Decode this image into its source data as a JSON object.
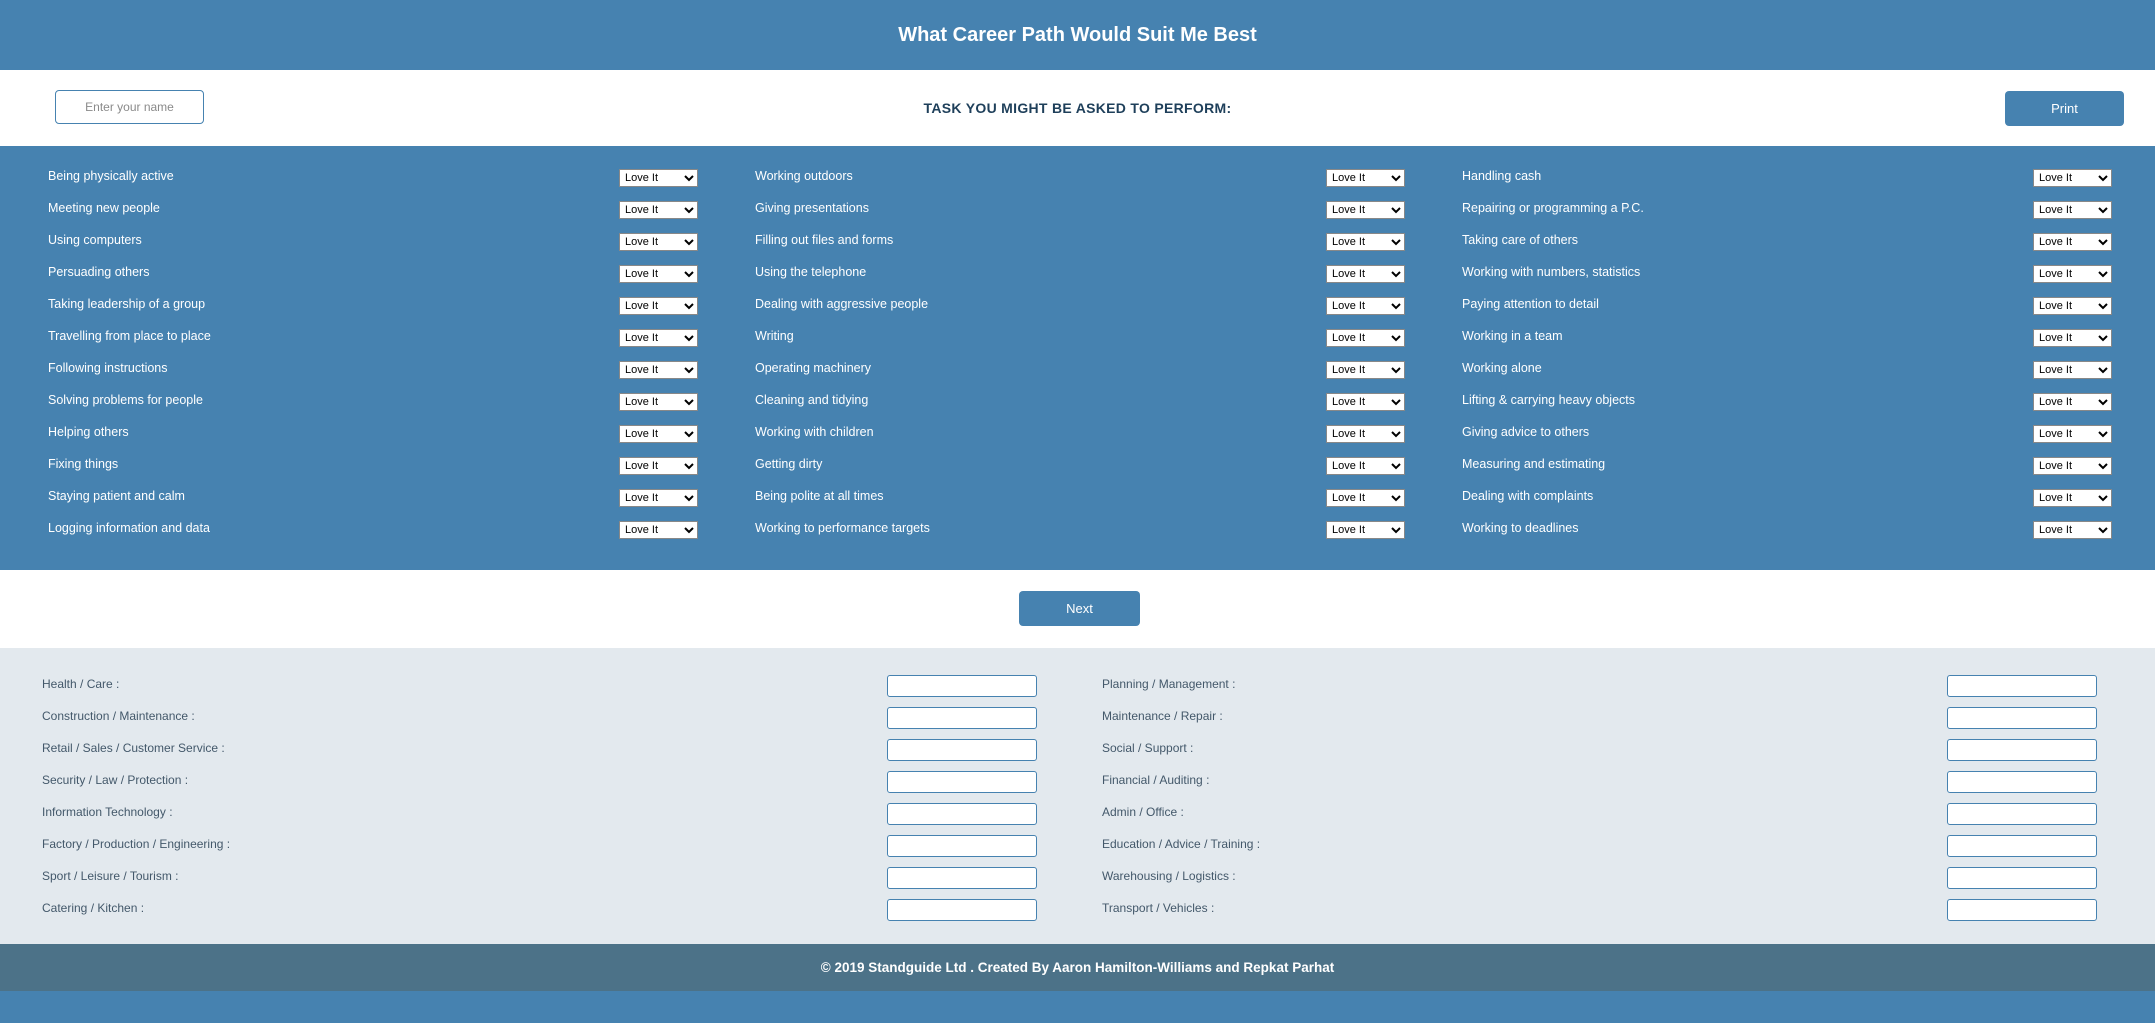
{
  "header": {
    "title": "What Career Path Would Suit Me Best"
  },
  "name_bar": {
    "name_placeholder": "Enter your name",
    "task_heading": "TASK YOU MIGHT BE ASKED TO PERFORM:",
    "print_label": "Print"
  },
  "tasks": {
    "selected_value": "Love It",
    "columns": [
      [
        "Being physically active",
        "Meeting new people",
        "Using computers",
        "Persuading others",
        "Taking leadership of a group",
        "Travelling from place to place",
        "Following instructions",
        "Solving problems for people",
        "Helping others",
        "Fixing things",
        "Staying patient and calm",
        "Logging information and data"
      ],
      [
        "Working outdoors",
        "Giving presentations",
        "Filling out files and forms",
        "Using the telephone",
        "Dealing with aggressive people",
        "Writing",
        "Operating machinery",
        "Cleaning and tidying",
        "Working with children",
        "Getting dirty",
        "Being polite at all times",
        "Working to performance targets"
      ],
      [
        "Handling cash",
        "Repairing or programming a P.C.",
        "Taking care of others",
        "Working with numbers, statistics",
        "Paying attention to detail",
        "Working in a team",
        "Working alone",
        "Lifting & carrying heavy objects",
        "Giving advice to others",
        "Measuring and estimating",
        "Dealing with complaints",
        "Working to deadlines"
      ]
    ]
  },
  "next_label": "Next",
  "results": {
    "columns": [
      [
        "Health / Care :",
        "Construction / Maintenance :",
        "Retail / Sales / Customer Service :",
        "Security / Law / Protection :",
        "Information Technology :",
        "Factory / Production / Engineering :",
        "Sport / Leisure / Tourism :",
        "Catering / Kitchen :"
      ],
      [
        "Planning / Management :",
        "Maintenance / Repair :",
        "Social / Support :",
        "Financial / Auditing :",
        "Admin / Office :",
        "Education / Advice / Training :",
        "Warehousing / Logistics :",
        "Transport / Vehicles :"
      ]
    ]
  },
  "footer": {
    "text": "© 2019 Standguide Ltd . Created By Aaron Hamilton-Williams and Repkat Parhat"
  },
  "colors": {
    "primary": "#4682b0",
    "footer": "#4c7288",
    "results_bg": "#e3e9ee"
  }
}
